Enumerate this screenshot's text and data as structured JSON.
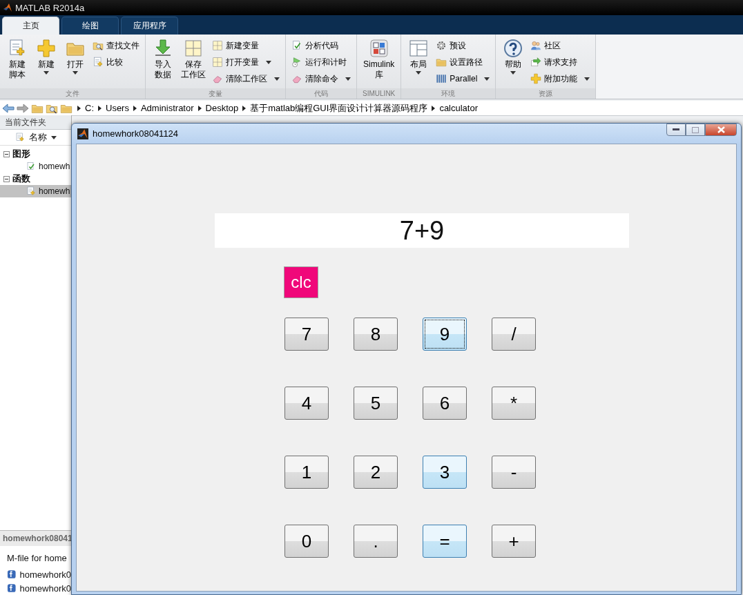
{
  "app_title": "MATLAB R2014a",
  "tabs": [
    {
      "label": "主页",
      "selected": true
    },
    {
      "label": "绘图",
      "selected": false
    },
    {
      "label": "应用程序",
      "selected": false
    }
  ],
  "ribbon": {
    "groups": [
      {
        "label": "文件",
        "columns": [
          {
            "kind": "large",
            "lines": [
              "新建",
              "脚本"
            ],
            "dropdown": false
          },
          {
            "kind": "large",
            "lines": [
              "新建"
            ],
            "dropdown": true
          },
          {
            "kind": "large",
            "lines": [
              "打开"
            ],
            "dropdown": true
          },
          {
            "kind": "stack",
            "items": [
              {
                "label": "查找文件",
                "dropdown": false
              },
              {
                "label": "比较",
                "dropdown": false
              }
            ]
          }
        ]
      },
      {
        "label": "变量",
        "columns": [
          {
            "kind": "large",
            "lines": [
              "导入",
              "数据"
            ],
            "dropdown": false
          },
          {
            "kind": "large",
            "lines": [
              "保存",
              "工作区"
            ],
            "dropdown": false
          },
          {
            "kind": "stack",
            "items": [
              {
                "label": "新建变量",
                "dropdown": false
              },
              {
                "label": "打开变量",
                "dropdown": true
              },
              {
                "label": "清除工作区",
                "dropdown": true
              }
            ]
          }
        ]
      },
      {
        "label": "代码",
        "columns": [
          {
            "kind": "stack",
            "items": [
              {
                "label": "分析代码",
                "dropdown": false
              },
              {
                "label": "运行和计时",
                "dropdown": false
              },
              {
                "label": "清除命令",
                "dropdown": true
              }
            ]
          }
        ]
      },
      {
        "label": "SIMULINK",
        "columns": [
          {
            "kind": "large",
            "lines": [
              "Simulink",
              "库"
            ],
            "dropdown": false
          }
        ]
      },
      {
        "label": "环境",
        "columns": [
          {
            "kind": "large",
            "lines": [
              "布局"
            ],
            "dropdown": true
          },
          {
            "kind": "stack",
            "items": [
              {
                "label": "预设",
                "dropdown": false
              },
              {
                "label": "设置路径",
                "dropdown": false
              },
              {
                "label": "Parallel",
                "dropdown": true
              }
            ]
          }
        ]
      },
      {
        "label": "资源",
        "columns": [
          {
            "kind": "large",
            "lines": [
              "帮助"
            ],
            "dropdown": true
          },
          {
            "kind": "stack",
            "items": [
              {
                "label": "社区",
                "dropdown": false
              },
              {
                "label": "请求支持",
                "dropdown": false
              },
              {
                "label": "附加功能",
                "dropdown": true
              }
            ]
          }
        ]
      }
    ]
  },
  "path": [
    "C:",
    "Users",
    "Administrator",
    "Desktop",
    "基于matlab编程GUI界面设计计算器源码程序",
    "calculator"
  ],
  "file_browser": {
    "title": "当前文件夹",
    "column": "名称",
    "tree": [
      {
        "label": "图形",
        "expanded": true,
        "children": [
          {
            "label": "homewh",
            "selected": false
          }
        ]
      },
      {
        "label": "函数",
        "expanded": true,
        "children": [
          {
            "label": "homewh",
            "selected": true
          }
        ]
      }
    ],
    "details": {
      "title": "homewhork08041",
      "description": "M-file for home",
      "files": [
        "homewhork0",
        "homewhork0"
      ]
    }
  },
  "figure": {
    "title": "homewhork08041124",
    "display": "7+9",
    "clear_button": "clc",
    "keys": [
      {
        "label": "7",
        "highlighted": false,
        "focused": false
      },
      {
        "label": "8",
        "highlighted": false,
        "focused": false
      },
      {
        "label": "9",
        "highlighted": true,
        "focused": true
      },
      {
        "label": "/",
        "highlighted": false,
        "focused": false
      },
      {
        "label": "4",
        "highlighted": false,
        "focused": false
      },
      {
        "label": "5",
        "highlighted": false,
        "focused": false
      },
      {
        "label": "6",
        "highlighted": false,
        "focused": false
      },
      {
        "label": "*",
        "highlighted": false,
        "focused": false
      },
      {
        "label": "1",
        "highlighted": false,
        "focused": false
      },
      {
        "label": "2",
        "highlighted": false,
        "focused": false
      },
      {
        "label": "3",
        "highlighted": true,
        "focused": false
      },
      {
        "label": "-",
        "highlighted": false,
        "focused": false
      },
      {
        "label": "0",
        "highlighted": false,
        "focused": false
      },
      {
        "label": ".",
        "highlighted": false,
        "focused": false
      },
      {
        "label": "=",
        "highlighted": true,
        "focused": false
      },
      {
        "label": "+",
        "highlighted": false,
        "focused": false
      }
    ]
  }
}
